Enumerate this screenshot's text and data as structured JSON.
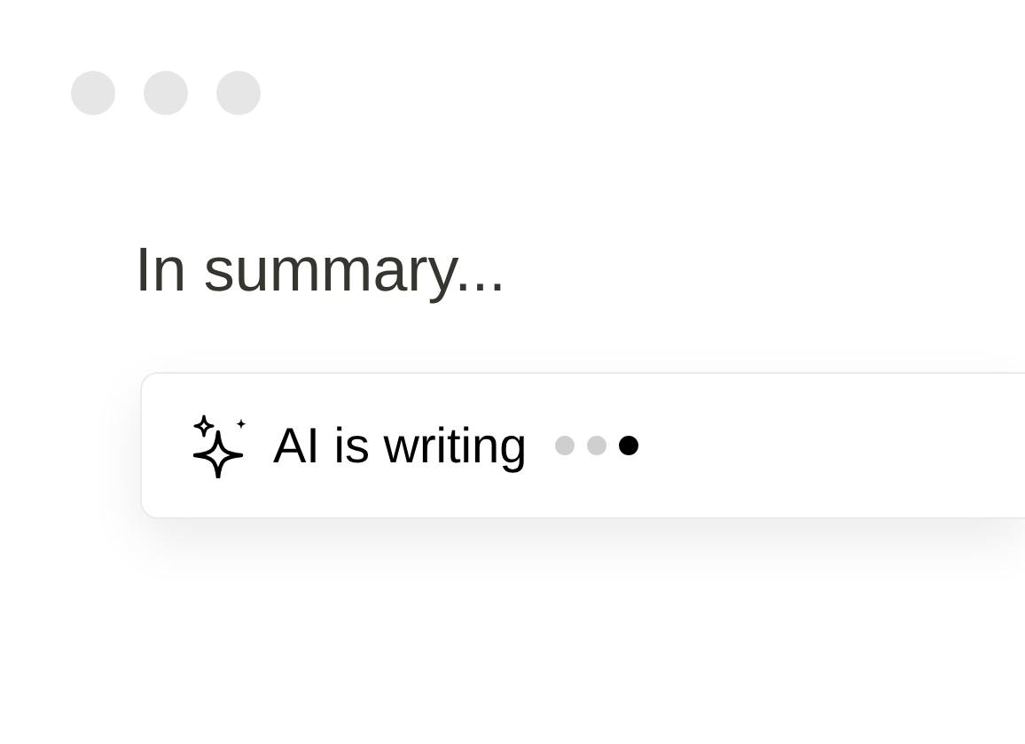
{
  "heading": "In summary...",
  "ai_status": {
    "label": "AI is writing",
    "dots": [
      {
        "active": false
      },
      {
        "active": false
      },
      {
        "active": true
      }
    ]
  }
}
